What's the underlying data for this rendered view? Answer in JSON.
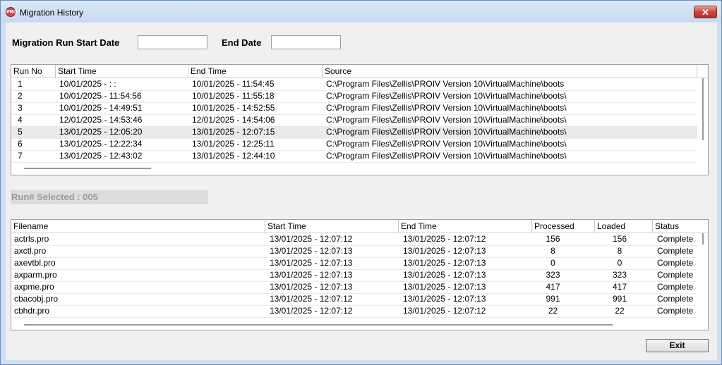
{
  "window": {
    "title": "Migration History",
    "icon_text": "PRO",
    "close_symbol": "✕"
  },
  "filters": {
    "start_label": "Migration Run Start Date",
    "start_value": "",
    "end_label": "End Date",
    "end_value": ""
  },
  "runs": {
    "columns": [
      "Run No",
      "Start Time",
      "End Time",
      "Source"
    ],
    "rows": [
      {
        "no": "1",
        "start": "10/01/2025 -   :  :",
        "end": "10/01/2025 - 11:54:45",
        "source": "C:\\Program Files\\Zellis\\PROIV Version 10\\VirtualMachine\\boots"
      },
      {
        "no": "2",
        "start": "10/01/2025 - 11:54:56",
        "end": "10/01/2025 - 11:55:18",
        "source": "C:\\Program Files\\Zellis\\PROIV Version 10\\VirtualMachine\\boots\\"
      },
      {
        "no": "3",
        "start": "10/01/2025 - 14:49:51",
        "end": "10/01/2025 - 14:52:55",
        "source": "C:\\Program Files\\Zellis\\PROIV Version 10\\VirtualMachine\\boots\\"
      },
      {
        "no": "4",
        "start": "12/01/2025 - 14:53:46",
        "end": "12/01/2025 - 14:54:06",
        "source": "C:\\Program Files\\Zellis\\PROIV Version 10\\VirtualMachine\\boots\\"
      },
      {
        "no": "5",
        "start": "13/01/2025 - 12:05:20",
        "end": "13/01/2025 - 12:07:15",
        "source": "C:\\Program Files\\Zellis\\PROIV Version 10\\VirtualMachine\\boots\\"
      },
      {
        "no": "6",
        "start": "13/01/2025 - 12:22:34",
        "end": "13/01/2025 - 12:25:11",
        "source": "C:\\Program Files\\Zellis\\PROIV Version 10\\VirtualMachine\\boots\\"
      },
      {
        "no": "7",
        "start": "13/01/2025 - 12:43:02",
        "end": "13/01/2025 - 12:44:10",
        "source": "C:\\Program Files\\Zellis\\PROIV Version 10\\VirtualMachine\\boots\\"
      }
    ]
  },
  "run_selected": "Run# Selected : 005",
  "files": {
    "columns": [
      "Filename",
      "Start Time",
      "End Time",
      "Processed",
      "Loaded",
      "Status"
    ],
    "rows": [
      {
        "name": "actrls.pro",
        "start": "13/01/2025 - 12:07:12",
        "end": "13/01/2025 - 12:07:12",
        "processed": "156",
        "loaded": "156",
        "status": "Complete"
      },
      {
        "name": "axctl.pro",
        "start": "13/01/2025 - 12:07:13",
        "end": "13/01/2025 - 12:07:13",
        "processed": "8",
        "loaded": "8",
        "status": "Complete"
      },
      {
        "name": "axevtbl.pro",
        "start": "13/01/2025 - 12:07:13",
        "end": "13/01/2025 - 12:07:13",
        "processed": "0",
        "loaded": "0",
        "status": "Complete"
      },
      {
        "name": "axparm.pro",
        "start": "13/01/2025 - 12:07:13",
        "end": "13/01/2025 - 12:07:13",
        "processed": "323",
        "loaded": "323",
        "status": "Complete"
      },
      {
        "name": "axpme.pro",
        "start": "13/01/2025 - 12:07:13",
        "end": "13/01/2025 - 12:07:13",
        "processed": "417",
        "loaded": "417",
        "status": "Complete"
      },
      {
        "name": "cbacobj.pro",
        "start": "13/01/2025 - 12:07:12",
        "end": "13/01/2025 - 12:07:13",
        "processed": "991",
        "loaded": "991",
        "status": "Complete"
      },
      {
        "name": "cbhdr.pro",
        "start": "13/01/2025 - 12:07:12",
        "end": "13/01/2025 - 12:07:12",
        "processed": "22",
        "loaded": "22",
        "status": "Complete"
      }
    ]
  },
  "buttons": {
    "exit": "Exit"
  }
}
